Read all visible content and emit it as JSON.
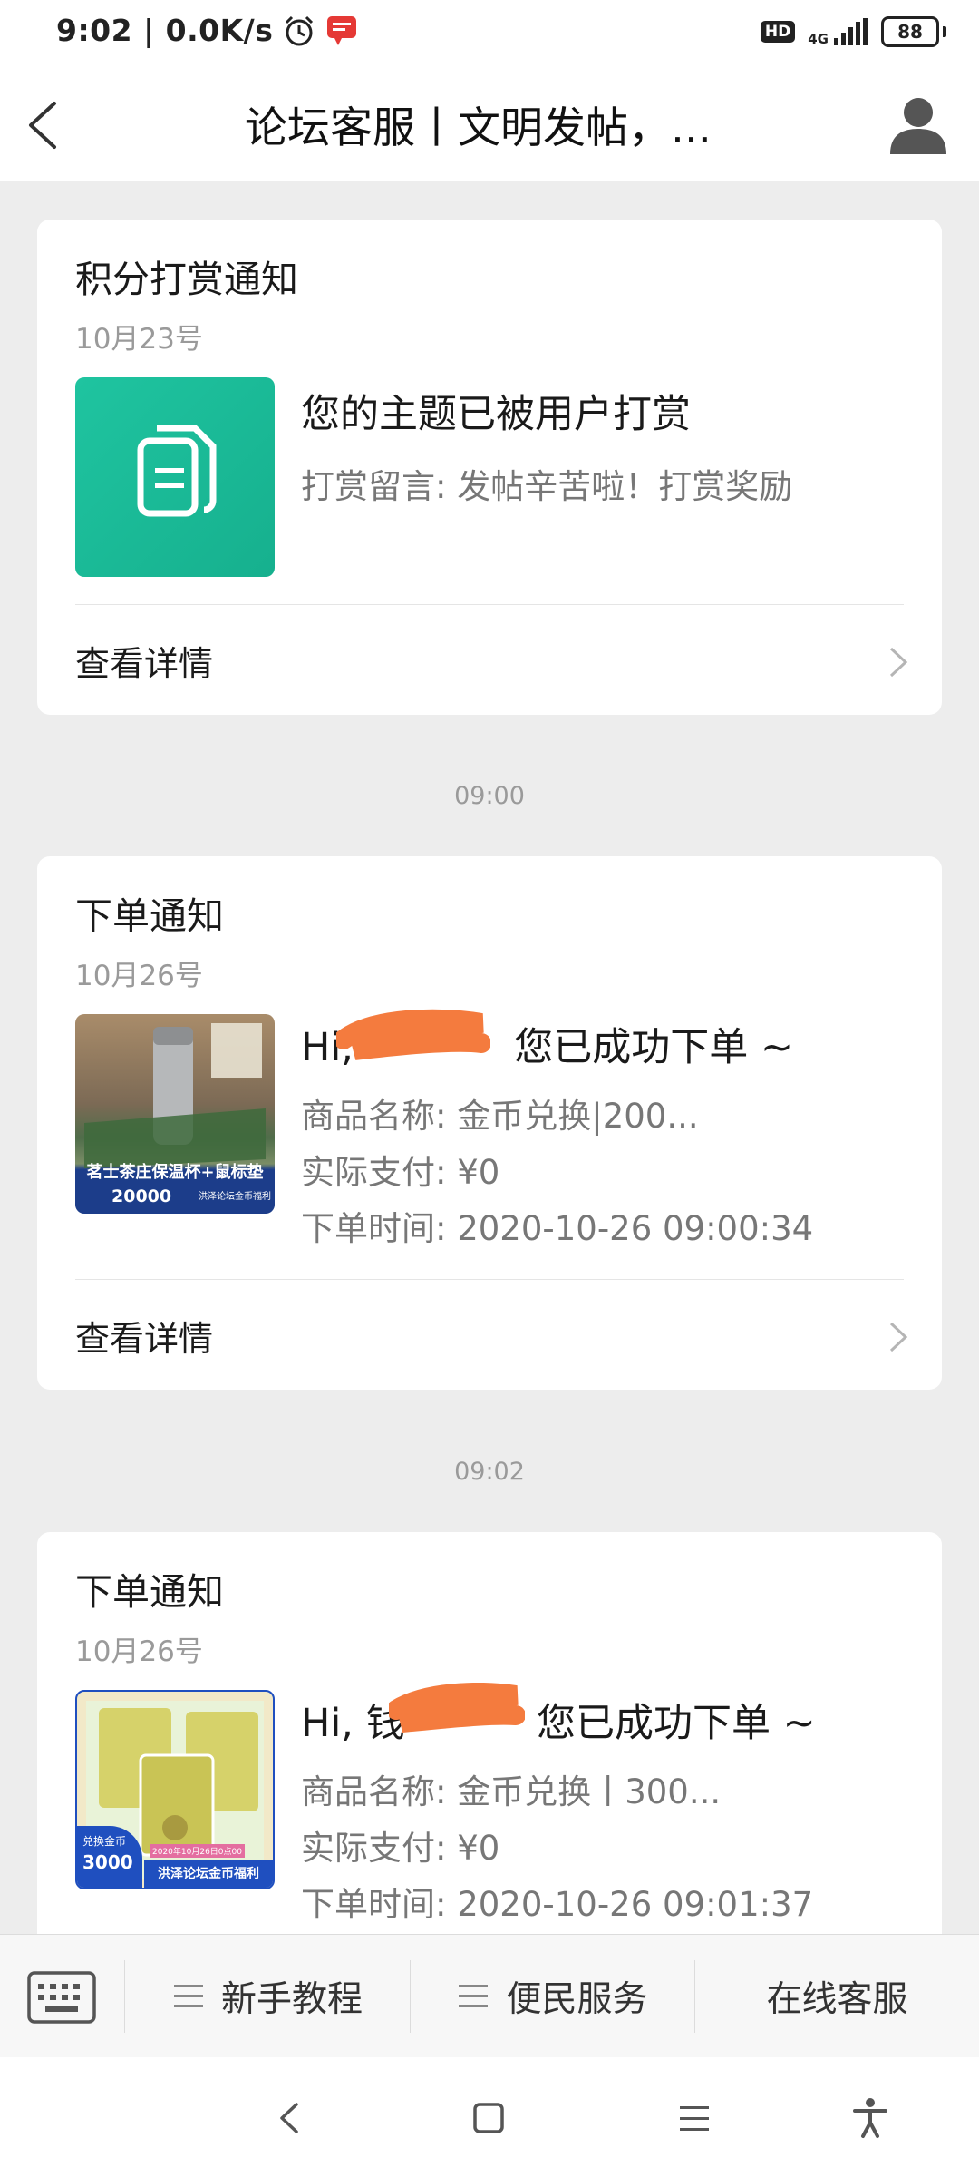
{
  "status_bar": {
    "time": "9:02",
    "speed": "0.0K/s",
    "hd": "HD",
    "network": "4G",
    "battery": "88"
  },
  "header": {
    "title": "论坛客服丨文明发帖，..."
  },
  "feed": [
    {
      "title": "积分打赏通知",
      "date": "10月23号",
      "headline": "您的主题已被用户打赏",
      "lines": [
        "打赏留言: 发帖辛苦啦！打赏奖励"
      ],
      "detail_label": "查看详情"
    },
    {
      "timestamp": "09:00",
      "title": "下单通知",
      "date": "10月26号",
      "headline_prefix": "Hi,",
      "headline_suffix": "您已成功下单 ~",
      "lines": [
        "商品名称: 金币兑换|200...",
        "实际支付: ¥0",
        "下单时间: 2020-10-26 09:00:34"
      ],
      "thumb_caption": "茗士茶庄保温杯+鼠标垫",
      "thumb_price": "20000",
      "thumb_brand": "洪泽论坛金币福利",
      "detail_label": "查看详情"
    },
    {
      "timestamp": "09:02",
      "title": "下单通知",
      "date": "10月26号",
      "headline_prefix": "Hi, 钱",
      "headline_suffix": "您已成功下单 ~",
      "lines": [
        "商品名称: 金币兑换丨300...",
        "实际支付: ¥0",
        "下单时间: 2020-10-26 09:01:37"
      ],
      "thumb_badge_label": "兑换金币",
      "thumb_price": "3000",
      "thumb_date": "2020年10月26日0点00",
      "thumb_brand": "洪泽论坛金币福利"
    }
  ],
  "menu": {
    "items": [
      "新手教程",
      "便民服务",
      "在线客服"
    ]
  },
  "colors": {
    "accent_teal": "#1fc4a0",
    "redaction_orange": "#f47b3e",
    "thumb_blue": "#1f4fbf"
  }
}
